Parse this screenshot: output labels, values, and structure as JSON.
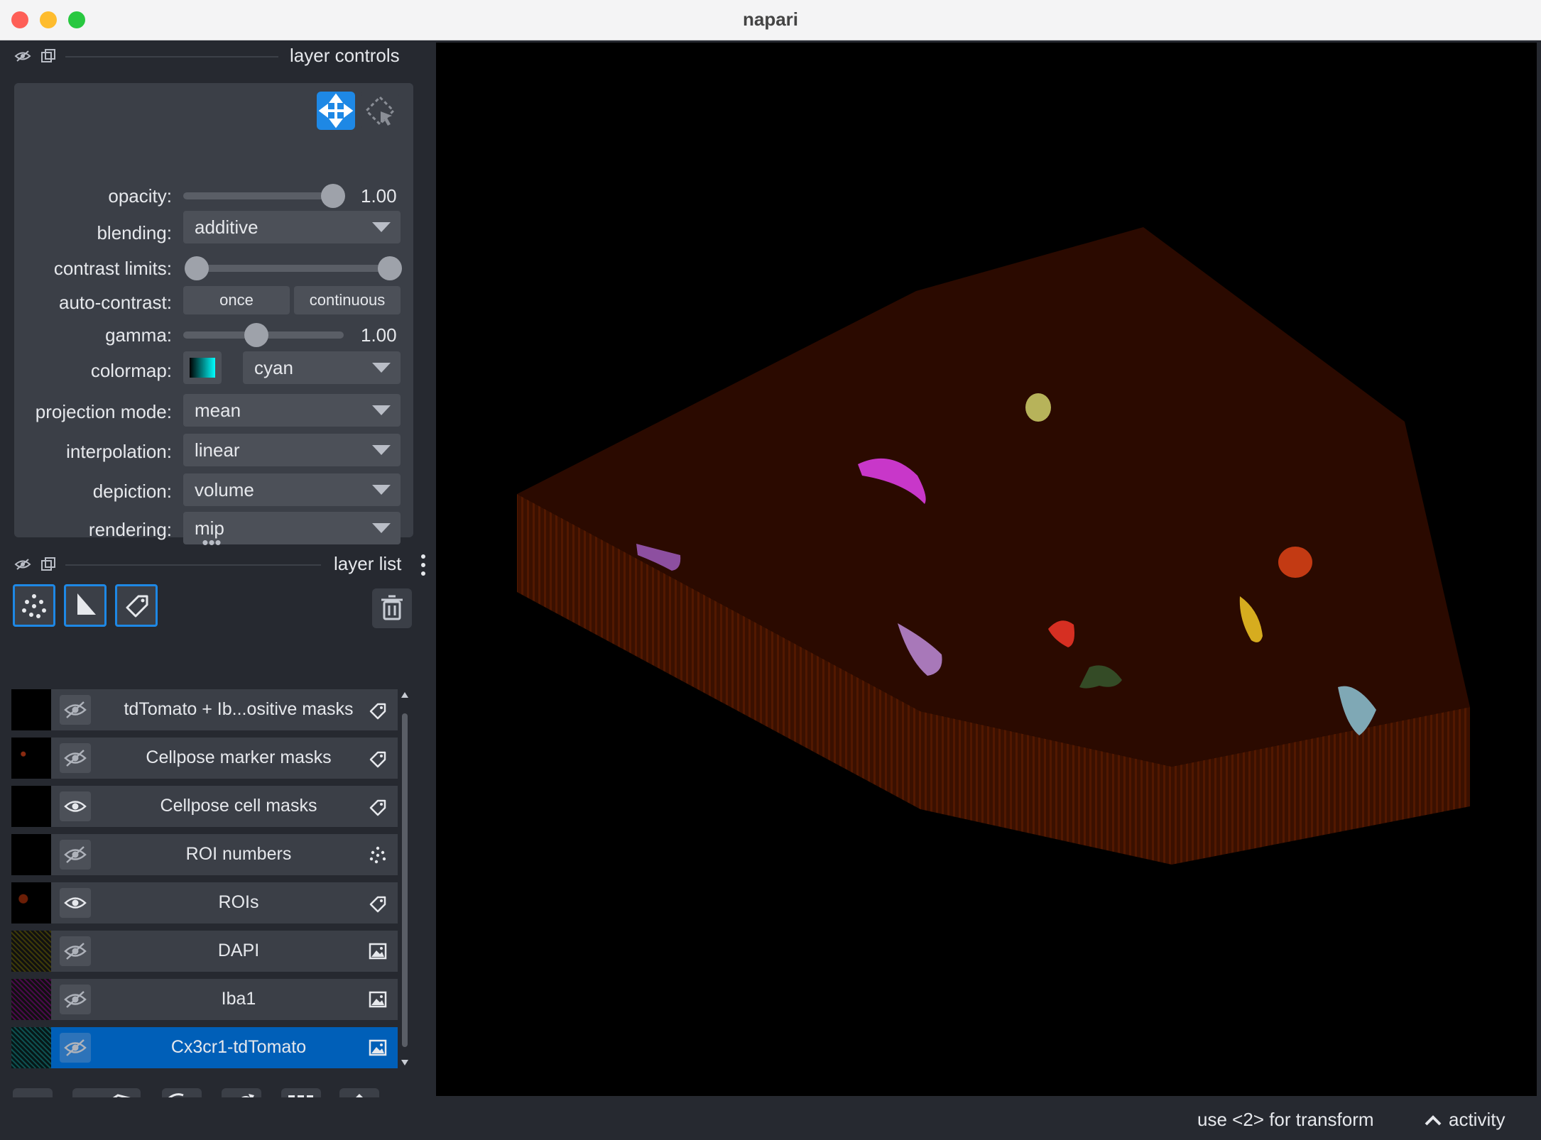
{
  "window": {
    "title": "napari"
  },
  "layer_controls": {
    "header": "layer controls",
    "rows": {
      "opacity_label": "opacity:",
      "opacity_value": "1.00",
      "opacity_level": 1.0,
      "blending_label": "blending:",
      "blending_value": "additive",
      "contrast_label": "contrast limits:",
      "auto_contrast_label": "auto-contrast:",
      "once_label": "once",
      "continuous_label": "continuous",
      "gamma_label": "gamma:",
      "gamma_value": "1.00",
      "colormap_label": "colormap:",
      "colormap_value": "cyan",
      "projection_label": "projection mode:",
      "projection_value": "mean",
      "interpolation_label": "interpolation:",
      "interpolation_value": "linear",
      "depiction_label": "depiction:",
      "depiction_value": "volume",
      "rendering_label": "rendering:",
      "rendering_value": "mip"
    }
  },
  "layer_list": {
    "header": "layer list",
    "layers": [
      {
        "name": "tdTomato + Ib...ositive masks",
        "type": "labels",
        "visible": false
      },
      {
        "name": "Cellpose marker masks",
        "type": "labels",
        "visible": false
      },
      {
        "name": "Cellpose cell masks",
        "type": "labels",
        "visible": true
      },
      {
        "name": "ROI numbers",
        "type": "points",
        "visible": false
      },
      {
        "name": "ROIs",
        "type": "labels",
        "visible": true
      },
      {
        "name": "DAPI",
        "type": "image",
        "visible": false
      },
      {
        "name": "Iba1",
        "type": "image",
        "visible": false
      },
      {
        "name": "Cx3cr1-tdTomato",
        "type": "image",
        "visible": false,
        "selected": true
      }
    ]
  },
  "status": {
    "hint": "use <2> for transform",
    "activity": "activity"
  },
  "colors": {
    "accent": "#1e88e5",
    "selected_row": "#005fb8",
    "panel_bg": "#262930",
    "control_bg": "#3b3f47",
    "volume": "#2b0a00"
  }
}
